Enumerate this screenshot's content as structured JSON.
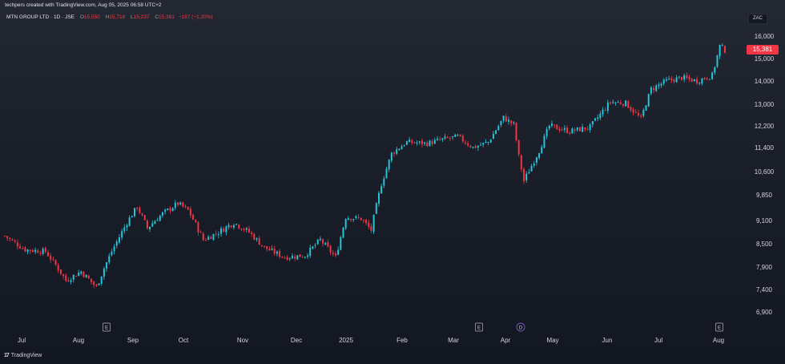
{
  "header": {
    "attribution": "techpers created with TradingView.com, Aug 05, 2025 06:58 UTC+2",
    "symbol": "MTN GROUP LTD · 1D · JSE",
    "ohlc": [
      {
        "label": "O",
        "value": "15,550"
      },
      {
        "label": "H",
        "value": "15,718"
      },
      {
        "label": "L",
        "value": "15,237"
      },
      {
        "label": "C",
        "value": "15,381"
      }
    ],
    "change": "−187 (−1.20%)"
  },
  "currency": "ZAC",
  "last_price": "15,381",
  "footer": {
    "brand": "TradingView",
    "brand_mark": "17"
  },
  "colors": {
    "up": "#26c6da",
    "down": "#f23645",
    "background": "#131722",
    "text": "#d1d4dc"
  },
  "events": [
    {
      "label": "E",
      "type": "earnings",
      "near": "Aug"
    },
    {
      "label": "E",
      "type": "earnings",
      "near": "Mar"
    },
    {
      "label": "D",
      "type": "dividend",
      "near": "Apr"
    },
    {
      "label": "E",
      "type": "earnings",
      "near": "Aug"
    }
  ],
  "chart_data": {
    "type": "candlestick",
    "title": "",
    "interval": "1D",
    "ylim": [
      6500,
      16500
    ],
    "y_ticks": [
      {
        "label": "16,000",
        "value": 16000
      },
      {
        "label": "15,000",
        "value": 15000
      },
      {
        "label": "14,000",
        "value": 14000
      },
      {
        "label": "13,000",
        "value": 13000
      },
      {
        "label": "12,200",
        "value": 12200
      },
      {
        "label": "11,400",
        "value": 11400
      },
      {
        "label": "10,600",
        "value": 10600
      },
      {
        "label": "9,850",
        "value": 9850
      },
      {
        "label": "9,100",
        "value": 9100
      },
      {
        "label": "8,500",
        "value": 8500
      },
      {
        "label": "7,900",
        "value": 7900
      },
      {
        "label": "7,400",
        "value": 7400
      },
      {
        "label": "6,900",
        "value": 6900
      }
    ],
    "x_ticks": [
      "Jul",
      "Aug",
      "Sep",
      "Oct",
      "Nov",
      "Dec",
      "2025",
      "Feb",
      "Mar",
      "Apr",
      "May",
      "Jun",
      "Jul",
      "Aug"
    ],
    "series": [
      {
        "name": "MTN GROUP LTD",
        "close_path": [
          {
            "i": 0,
            "c": 8700
          },
          {
            "i": 8,
            "c": 8350
          },
          {
            "i": 16,
            "c": 8300
          },
          {
            "i": 24,
            "c": 7600
          },
          {
            "i": 30,
            "c": 7800
          },
          {
            "i": 36,
            "c": 7450
          },
          {
            "i": 42,
            "c": 8300
          },
          {
            "i": 48,
            "c": 9050
          },
          {
            "i": 52,
            "c": 9500
          },
          {
            "i": 56,
            "c": 8900
          },
          {
            "i": 62,
            "c": 9300
          },
          {
            "i": 68,
            "c": 9600
          },
          {
            "i": 72,
            "c": 9400
          },
          {
            "i": 78,
            "c": 8600
          },
          {
            "i": 84,
            "c": 8800
          },
          {
            "i": 90,
            "c": 9050
          },
          {
            "i": 96,
            "c": 8800
          },
          {
            "i": 102,
            "c": 8400
          },
          {
            "i": 110,
            "c": 8150
          },
          {
            "i": 118,
            "c": 8200
          },
          {
            "i": 124,
            "c": 8600
          },
          {
            "i": 130,
            "c": 8150
          },
          {
            "i": 134,
            "c": 9200
          },
          {
            "i": 140,
            "c": 9150
          },
          {
            "i": 144,
            "c": 8850
          },
          {
            "i": 148,
            "c": 10200
          },
          {
            "i": 152,
            "c": 11200
          },
          {
            "i": 158,
            "c": 11600
          },
          {
            "i": 166,
            "c": 11550
          },
          {
            "i": 172,
            "c": 11700
          },
          {
            "i": 178,
            "c": 11800
          },
          {
            "i": 184,
            "c": 11400
          },
          {
            "i": 190,
            "c": 11600
          },
          {
            "i": 196,
            "c": 12500
          },
          {
            "i": 200,
            "c": 12250
          },
          {
            "i": 202,
            "c": 11100
          },
          {
            "i": 204,
            "c": 10300
          },
          {
            "i": 210,
            "c": 11300
          },
          {
            "i": 214,
            "c": 12200
          },
          {
            "i": 222,
            "c": 12000
          },
          {
            "i": 230,
            "c": 12150
          },
          {
            "i": 238,
            "c": 13100
          },
          {
            "i": 244,
            "c": 13050
          },
          {
            "i": 250,
            "c": 12450
          },
          {
            "i": 254,
            "c": 13650
          },
          {
            "i": 260,
            "c": 14000
          },
          {
            "i": 266,
            "c": 14150
          },
          {
            "i": 272,
            "c": 14000
          },
          {
            "i": 278,
            "c": 14250
          },
          {
            "i": 281,
            "c": 15550
          },
          {
            "i": 283,
            "c": 15381
          }
        ]
      }
    ]
  }
}
